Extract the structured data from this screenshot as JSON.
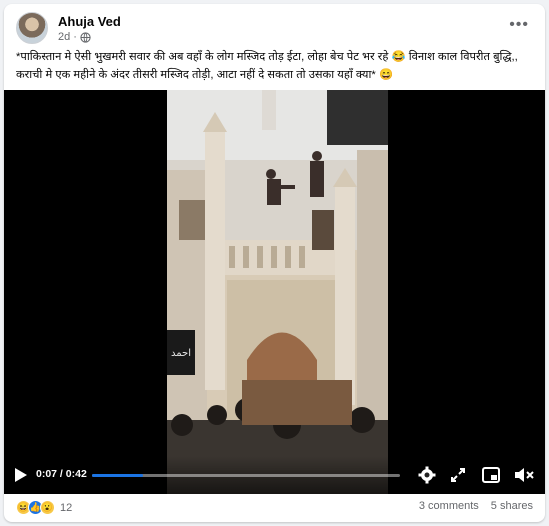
{
  "post": {
    "author": "Ahuja Ved",
    "time": "2d",
    "caption": "*पाकिस्तान मे ऐसी भुखमरी सवार की अब वहाँ के लोग मस्जिद तोड़ ईटा, लोहा बेच पेट भर रहे 😂 विनाश काल विपरीत बुद्धि,, कराची मे एक महीने के अंदर तीसरी मस्जिद तोड़ी, आटा नहीं दे सकता तो उसका यहाँ क्या* 😄",
    "more_icon": "more-dots-icon",
    "privacy_icon": "globe-icon"
  },
  "video": {
    "time_display": "0:07 / 0:42",
    "progress": 0.167,
    "sign_text": "احمد",
    "controls": [
      "play-icon",
      "gear-icon",
      "expand-icon",
      "pip-icon",
      "mute-icon"
    ]
  },
  "footer": {
    "reaction_count": "12",
    "comments": "3 comments",
    "shares": "5 shares",
    "reaction_icons": [
      "laugh-reaction-icon",
      "like-reaction-icon",
      "wow-reaction-icon"
    ]
  },
  "colors": {
    "accent": "#1b74e4",
    "text_secondary": "#65676b",
    "card_bg": "#ffffff",
    "page_bg": "#f0f2f5"
  }
}
